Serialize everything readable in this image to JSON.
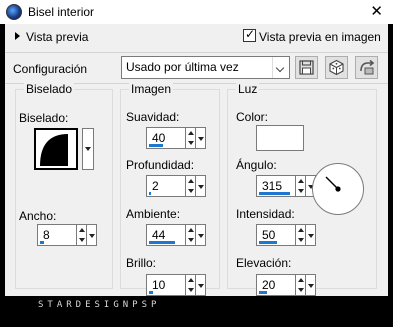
{
  "window": {
    "title": "Bisel interior",
    "close_glyph": "✕"
  },
  "preview": {
    "label": "Vista previa",
    "image_preview_label": "Vista previa en imagen",
    "image_preview_checked": true
  },
  "config": {
    "label": "Configuración",
    "preset_value": "Usado por última vez",
    "buttons": [
      "save-preset-icon",
      "random-icon",
      "reset-icon"
    ]
  },
  "bevel": {
    "title": "Biselado",
    "bevel_label": "Biselado:",
    "width_label": "Ancho:",
    "width_value": "8",
    "width_fill": 0.1
  },
  "image": {
    "title": "Imagen",
    "smoothness_label": "Suavidad:",
    "smoothness_value": "40",
    "smoothness_fill": 0.4,
    "depth_label": "Profundidad:",
    "depth_value": "2",
    "depth_fill": 0.05,
    "ambient_label": "Ambiente:",
    "ambient_value": "44",
    "ambient_fill": 0.72,
    "brightness_label": "Brillo:",
    "brightness_value": "10",
    "brightness_fill": 0.1
  },
  "light": {
    "title": "Luz",
    "color_label": "Color:",
    "color_value": "#ffffff",
    "angle_label": "Ángulo:",
    "angle_value": "315",
    "angle_fill": 0.87,
    "intensity_label": "Intensidad:",
    "intensity_value": "50",
    "intensity_fill": 0.5,
    "elevation_label": "Elevación:",
    "elevation_value": "20",
    "elevation_fill": 0.22
  },
  "watermark": "STARDESIGNPSP",
  "colors": {
    "accent": "#1e78d2",
    "background": "#f0f0f0",
    "frame": "#000000"
  }
}
